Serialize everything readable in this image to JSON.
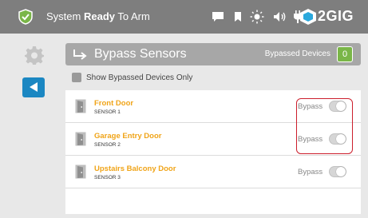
{
  "topbar": {
    "status_prefix": "System ",
    "status_bold": "Ready",
    "status_suffix": " To Arm",
    "brand": "2GIG",
    "icons": [
      "check-shield-icon",
      "message-icon",
      "bookmark-icon",
      "sun-icon",
      "volume-icon",
      "plug-icon",
      "2gig-logo-icon"
    ]
  },
  "sidebar": {
    "icons": [
      "gear-icon",
      "back-arrow-icon"
    ]
  },
  "header": {
    "title": "Bypass Sensors",
    "bypassed_label": "Bypassed Devices",
    "bypassed_count": "0"
  },
  "filter": {
    "label": "Show Bypassed Devices Only"
  },
  "devices": [
    {
      "name": "Front Door",
      "sensor": "SENSOR 1",
      "bypass_label": "Bypass",
      "bypassed": false
    },
    {
      "name": "Garage Entry Door",
      "sensor": "SENSOR 2",
      "bypass_label": "Bypass",
      "bypassed": false
    },
    {
      "name": "Upstairs Balcony Door",
      "sensor": "SENSOR 3",
      "bypass_label": "Bypass",
      "bypassed": false
    }
  ],
  "colors": {
    "accent": "#f0a418",
    "topbar": "#7e7e7e",
    "back_button": "#1b87c2",
    "badge": "#7ab648",
    "highlight": "#cc1e2c"
  }
}
